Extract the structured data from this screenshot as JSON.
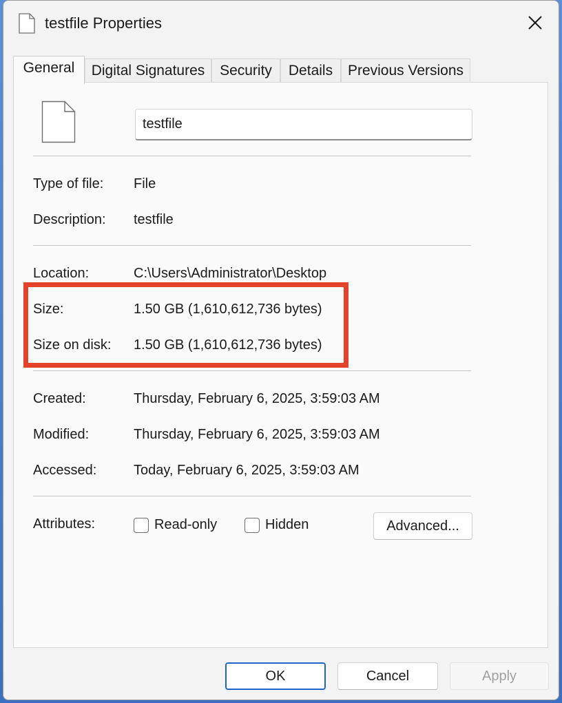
{
  "window": {
    "title": "testfile Properties",
    "close_icon": "close-icon",
    "file_icon": "file-icon"
  },
  "tabs": [
    {
      "label": "General",
      "active": true
    },
    {
      "label": "Digital Signatures",
      "active": false
    },
    {
      "label": "Security",
      "active": false
    },
    {
      "label": "Details",
      "active": false
    },
    {
      "label": "Previous Versions",
      "active": false
    }
  ],
  "general": {
    "file_name": "testfile",
    "type_label": "Type of file:",
    "type_value": "File",
    "description_label": "Description:",
    "description_value": "testfile",
    "location_label": "Location:",
    "location_value": "C:\\Users\\Administrator\\Desktop",
    "size_label": "Size:",
    "size_value": "1.50 GB (1,610,612,736 bytes)",
    "size_on_disk_label": "Size on disk:",
    "size_on_disk_value": "1.50 GB (1,610,612,736 bytes)",
    "created_label": "Created:",
    "created_value": "Thursday, February 6, 2025, 3:59:03 AM",
    "modified_label": "Modified:",
    "modified_value": "Thursday, February 6, 2025, 3:59:03 AM",
    "accessed_label": "Accessed:",
    "accessed_value": "Today, February 6, 2025, 3:59:03 AM",
    "attributes_label": "Attributes:",
    "readonly_label": "Read-only",
    "readonly_checked": false,
    "hidden_label": "Hidden",
    "hidden_checked": false,
    "advanced_label": "Advanced..."
  },
  "footer": {
    "ok_label": "OK",
    "cancel_label": "Cancel",
    "apply_label": "Apply"
  },
  "colors": {
    "highlight": "#e2432a",
    "ok_border": "#1e64c8"
  }
}
